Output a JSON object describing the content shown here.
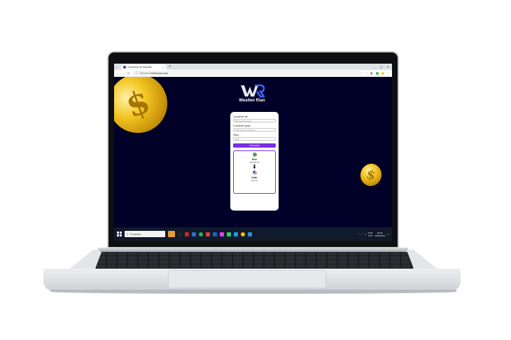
{
  "browser": {
    "tab_title": "Conversor de Moedas",
    "tab_close": "×",
    "new_tab": "+",
    "url": "127.0.0.1:5500/index.html",
    "window_controls": [
      "–",
      "▢",
      "✕"
    ]
  },
  "page": {
    "brand": "Wesllen Rian",
    "form": {
      "from_label": "Converter de:",
      "from_value": "R$ Real Brasileiro",
      "to_label": "Converter para:",
      "to_value": "US$ Dólar americano",
      "amount_label": "Valor",
      "amount_value": "500",
      "convert_button": "Converter"
    },
    "result": {
      "from_currency": "Real",
      "from_amount": "R$ 500,00",
      "arrow": "⬇",
      "to_currency": "Dólar",
      "to_amount": "$ 93,57"
    }
  },
  "taskbar": {
    "search_placeholder": "Pesquisar",
    "lang_top": "POR",
    "lang_bottom": "PTB",
    "time": "09:35",
    "date": "10/05/2024"
  },
  "colors": {
    "page_bg": "#000028",
    "accent": "#7b2fe0",
    "taskbar": "#111a2b"
  }
}
